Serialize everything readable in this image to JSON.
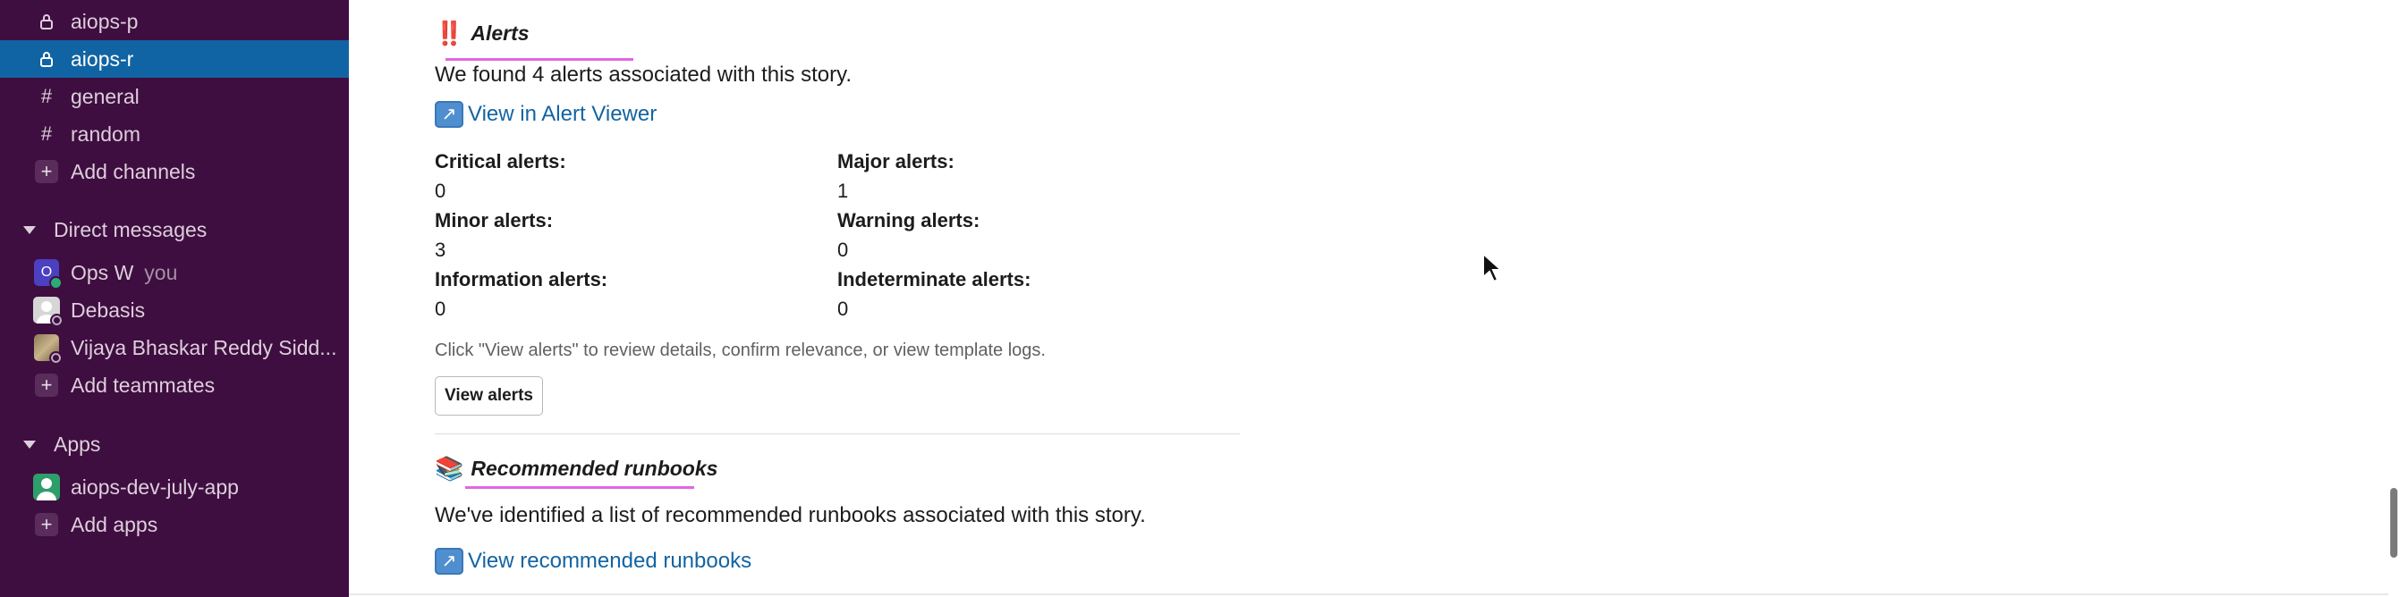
{
  "sidebar": {
    "channels": [
      {
        "label": "aiops-p",
        "icon": "lock-icon",
        "active": false
      },
      {
        "label": "aiops-r",
        "icon": "lock-icon",
        "active": true
      },
      {
        "label": "general",
        "icon": "hash-icon",
        "active": false
      },
      {
        "label": "random",
        "icon": "hash-icon",
        "active": false
      }
    ],
    "add_channels": "Add channels",
    "dm_section": "Direct messages",
    "dms": [
      {
        "label": "Ops W",
        "suffix": "you",
        "avatar_letter": "O"
      },
      {
        "label": "Debasis"
      },
      {
        "label": "Vijaya Bhaskar Reddy Sidd..."
      }
    ],
    "add_teammates": "Add teammates",
    "apps_section": "Apps",
    "apps": [
      {
        "label": "aiops-dev-july-app"
      }
    ],
    "add_apps": "Add apps"
  },
  "alerts": {
    "emoji": "‼️",
    "title": "Alerts",
    "summary": "We found 4 alerts associated with this story.",
    "viewer_link": "View in Alert Viewer",
    "fields": [
      {
        "label": "Critical alerts:",
        "value": "0"
      },
      {
        "label": "Major alerts:",
        "value": "1"
      },
      {
        "label": "Minor alerts:",
        "value": "3"
      },
      {
        "label": "Warning alerts:",
        "value": "0"
      },
      {
        "label": "Information alerts:",
        "value": "0"
      },
      {
        "label": "Indeterminate alerts:",
        "value": "0"
      }
    ],
    "hint": "Click \"View alerts\" to review details, confirm relevance, or view template logs.",
    "button": "View alerts"
  },
  "runbooks": {
    "emoji": "📚",
    "title": "Recommended runbooks",
    "summary": "We've identified a list of recommended runbooks associated with this story.",
    "link": "View recommended runbooks"
  },
  "colors": {
    "sidebar_bg": "#3f0e40",
    "active_bg": "#1164a3",
    "link": "#1264a3",
    "underline": "#e067e0"
  }
}
